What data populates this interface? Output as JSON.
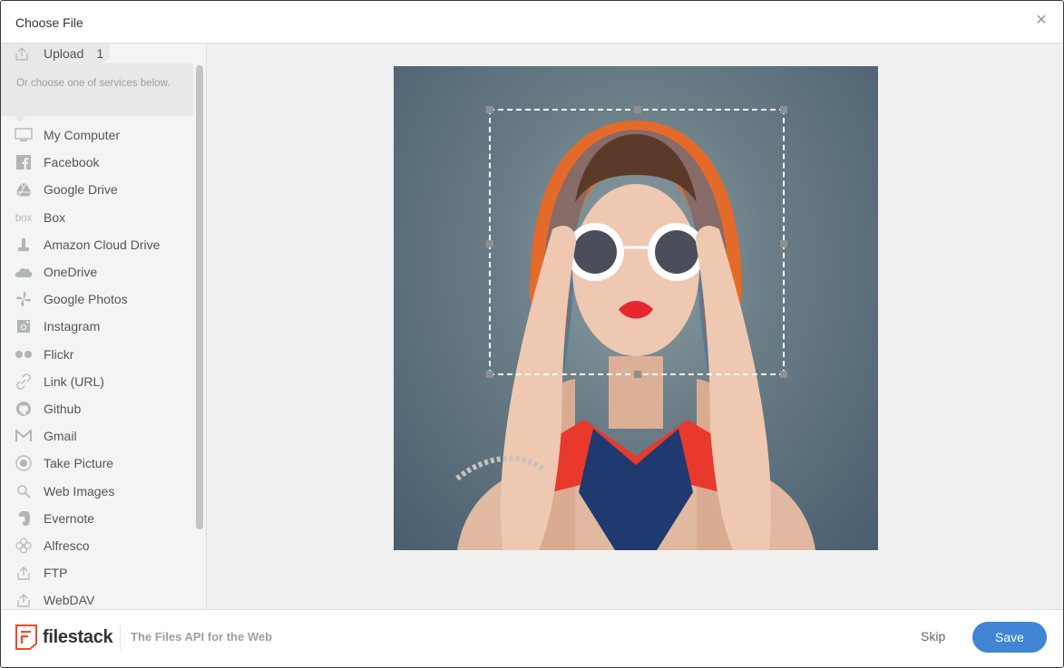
{
  "header": {
    "title": "Choose File",
    "close_icon": "close-icon"
  },
  "sidebar": {
    "upload": {
      "label": "Upload",
      "count": "1",
      "icon": "upload-icon"
    },
    "hint": "Or choose one of services below.",
    "services": [
      {
        "label": "My Computer",
        "icon": "monitor-icon"
      },
      {
        "label": "Facebook",
        "icon": "facebook-icon"
      },
      {
        "label": "Google Drive",
        "icon": "google-drive-icon"
      },
      {
        "label": "Box",
        "icon": "box-icon",
        "icon_text": "box"
      },
      {
        "label": "Amazon Cloud Drive",
        "icon": "amazon-cloud-drive-icon"
      },
      {
        "label": "OneDrive",
        "icon": "onedrive-icon"
      },
      {
        "label": "Google Photos",
        "icon": "google-photos-icon"
      },
      {
        "label": "Instagram",
        "icon": "instagram-icon"
      },
      {
        "label": "Flickr",
        "icon": "flickr-icon"
      },
      {
        "label": "Link (URL)",
        "icon": "link-icon"
      },
      {
        "label": "Github",
        "icon": "github-icon"
      },
      {
        "label": "Gmail",
        "icon": "gmail-icon"
      },
      {
        "label": "Take Picture",
        "icon": "camera-icon"
      },
      {
        "label": "Web Images",
        "icon": "search-icon"
      },
      {
        "label": "Evernote",
        "icon": "evernote-icon"
      },
      {
        "label": "Alfresco",
        "icon": "alfresco-icon"
      },
      {
        "label": "FTP",
        "icon": "ftp-icon"
      },
      {
        "label": "WebDAV",
        "icon": "webdav-icon"
      }
    ]
  },
  "editor": {
    "image": "portrait-photo",
    "crop_icon": "crop-selection"
  },
  "footer": {
    "brand": "filestack",
    "tagline": "The Files API for the Web",
    "skip_label": "Skip",
    "save_label": "Save"
  },
  "colors": {
    "accent": "#3f85d3",
    "brand": "#ef4a25",
    "sidebar_bg": "#f4f4f4",
    "canvas_bg": "#f1f1f1"
  }
}
